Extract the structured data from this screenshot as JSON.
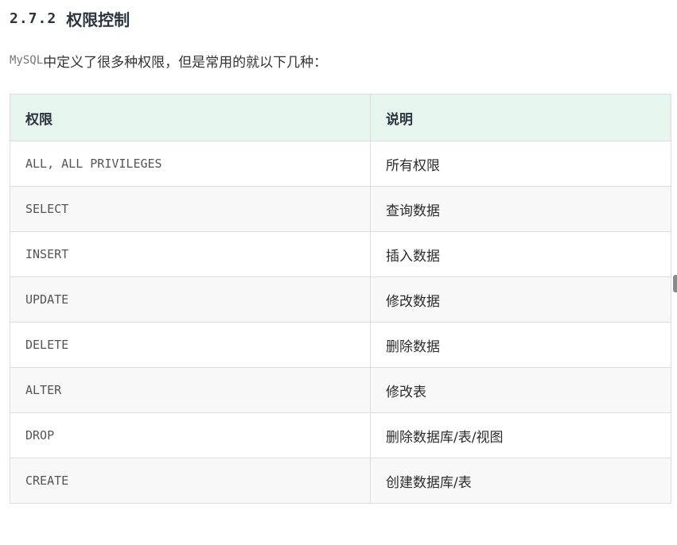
{
  "section": {
    "number": "2.7.2",
    "title": "权限控制"
  },
  "intro": {
    "code": "MySQL",
    "text": "中定义了很多种权限，但是常用的就以下几种："
  },
  "table": {
    "headers": [
      "权限",
      "说明"
    ],
    "rows": [
      {
        "privilege": "ALL, ALL PRIVILEGES",
        "description": "所有权限"
      },
      {
        "privilege": "SELECT",
        "description": "查询数据"
      },
      {
        "privilege": "INSERT",
        "description": "插入数据"
      },
      {
        "privilege": "UPDATE",
        "description": "修改数据"
      },
      {
        "privilege": "DELETE",
        "description": "删除数据"
      },
      {
        "privilege": "ALTER",
        "description": "修改表"
      },
      {
        "privilege": "DROP",
        "description": "删除数据库/表/视图"
      },
      {
        "privilege": "CREATE",
        "description": "创建数据库/表"
      }
    ]
  }
}
